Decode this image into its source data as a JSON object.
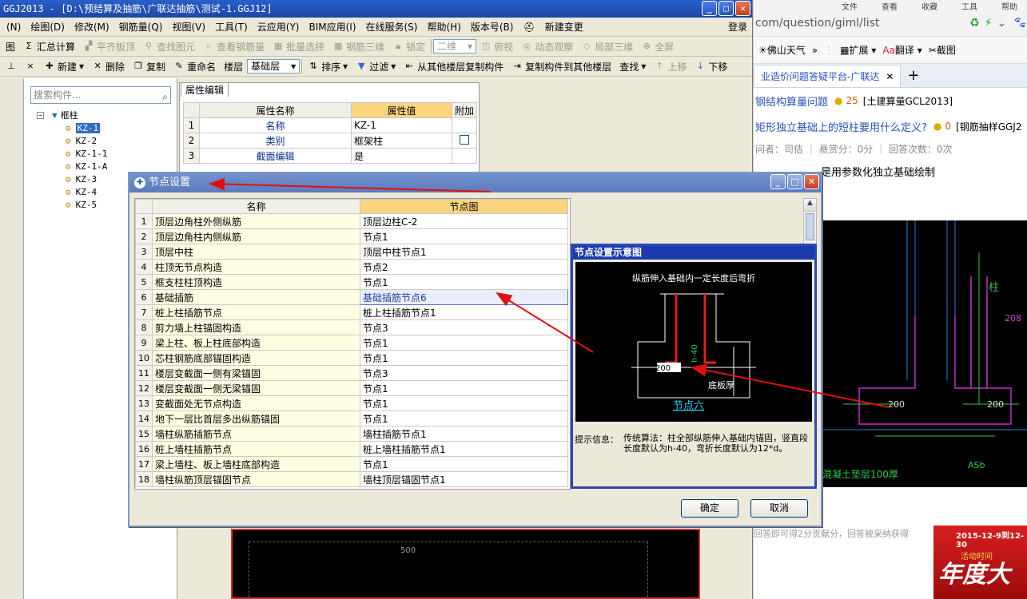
{
  "main_window": {
    "title": "GGJ2013 - [D:\\预结算及抽筋\\广联达抽筋\\测试-1.GGJ12]",
    "menus": [
      "(N)",
      "绘图(D)",
      "修改(M)",
      "钢筋量(Q)",
      "视图(V)",
      "工具(T)",
      "云应用(Y)",
      "BIM应用(I)",
      "在线服务(S)",
      "帮助(H)",
      "版本号(B)",
      "新建变更"
    ],
    "login": "登录",
    "toolbar1": [
      "图",
      "汇总计算",
      "平齐板顶",
      "查找图元",
      "查看钢筋量",
      "批量选择",
      "钢筋三维",
      "锁定",
      "二维",
      "俯视",
      "动态观察",
      "局部三维",
      "全屏"
    ],
    "toolbar2": [
      "新建",
      "删除",
      "复制",
      "重命名",
      "楼层",
      "基础层",
      "排序",
      "过滤",
      "从其他楼层复制构件",
      "复制构件到其他楼层",
      "查找",
      "上移",
      "下移"
    ]
  },
  "tree": {
    "search_placeholder": "搜索构件...",
    "root": "框柱",
    "items": [
      "KZ-1",
      "KZ-2",
      "KZ-1-1",
      "KZ-1-A",
      "KZ-3",
      "KZ-4",
      "KZ-5"
    ]
  },
  "property": {
    "tab": "属性编辑",
    "headers": [
      "属性名称",
      "属性值",
      "附加"
    ],
    "rows": [
      {
        "n": "1",
        "name": "名称",
        "value": "KZ-1"
      },
      {
        "n": "2",
        "name": "类别",
        "value": "框架柱"
      },
      {
        "n": "3",
        "name": "截面编辑",
        "value": "是"
      }
    ]
  },
  "dialog": {
    "title": "节点设置",
    "headers": [
      "名称",
      "节点图"
    ],
    "rows": [
      {
        "n": "1",
        "name": "顶层边角柱外侧纵筋",
        "value": "顶层边柱C-2"
      },
      {
        "n": "2",
        "name": "顶层边角柱内侧纵筋",
        "value": "节点1"
      },
      {
        "n": "3",
        "name": "顶层中柱",
        "value": "顶层中柱节点1"
      },
      {
        "n": "4",
        "name": "柱顶无节点构造",
        "value": "节点2"
      },
      {
        "n": "5",
        "name": "框支柱柱顶构造",
        "value": "节点1"
      },
      {
        "n": "6",
        "name": "基础插筋",
        "value": "基础插筋节点6"
      },
      {
        "n": "7",
        "name": "桩上柱插筋节点",
        "value": "桩上柱插筋节点1"
      },
      {
        "n": "8",
        "name": "剪力墙上柱锚固构造",
        "value": "节点3"
      },
      {
        "n": "9",
        "name": "梁上柱、板上柱底部构造",
        "value": "节点1"
      },
      {
        "n": "10",
        "name": "芯柱钢筋底部锚固构造",
        "value": "节点1"
      },
      {
        "n": "11",
        "name": "楼层变截面一侧有梁锚固",
        "value": "节点3"
      },
      {
        "n": "12",
        "name": "楼层变截面一侧无梁锚固",
        "value": "节点1"
      },
      {
        "n": "13",
        "name": "变截面处无节点构造",
        "value": "节点1"
      },
      {
        "n": "14",
        "name": "地下一层比首层多出纵筋锚固",
        "value": "节点1"
      },
      {
        "n": "15",
        "name": "墙柱纵筋插筋节点",
        "value": "墙柱插筋节点1"
      },
      {
        "n": "16",
        "name": "桩上墙柱插筋节点",
        "value": "桩上墙柱插筋节点1"
      },
      {
        "n": "17",
        "name": "梁上墙柱、板上墙柱底部构造",
        "value": "节点1"
      },
      {
        "n": "18",
        "name": "墙柱纵筋顶层锚固节点",
        "value": "墙柱顶层锚固节点1"
      }
    ],
    "preview_title": "节点设置示意图",
    "preview_caption": "纵筋伸入基础内一定长度后弯折",
    "preview_dim": "200",
    "preview_dim2": "h-40",
    "preview_slab": "底板厚",
    "preview_node_label": "节点六",
    "hint_label": "提示信息：",
    "hint_text": "传统算法：柱全部纵筋伸入基础内锚固，竖直段长度默认为h-40，弯折长度默认为12*d。",
    "ok": "确定",
    "cancel": "取消"
  },
  "browser": {
    "top_menu": [
      "文件",
      "查看",
      "收藏",
      "工具",
      "帮助"
    ],
    "url": "com/question/giml/list",
    "bookmarks": [
      "佛山天气",
      "扩展",
      "翻译",
      "截图"
    ],
    "tab_label": "业造价问题答疑平台-广联达",
    "q1_link": "钢结构算量问题",
    "q1_score": "25",
    "q1_tag": "[土建算量GCL2013]",
    "q2_link": "矩形独立基础上的短柱要用什么定义?",
    "q2_score": "0",
    "q2_tag": "[钢筋抽样GGJ2",
    "meta": "问者：司佶 ｜ 悬赏分：0分 ｜ 回答次数：0次",
    "answer": "是用参数化独立基础绘制",
    "cad_labels": [
      "柱",
      "208",
      "200",
      "200",
      "ASb",
      "混凝土垫层100厚"
    ],
    "bottom_text": "回答即可得2分贡献分，回答被采纳获得",
    "promo_date": "2015-12-9到12-30",
    "promo_text": "活动时间",
    "promo_big": "年度大"
  },
  "canvas_label": "500"
}
